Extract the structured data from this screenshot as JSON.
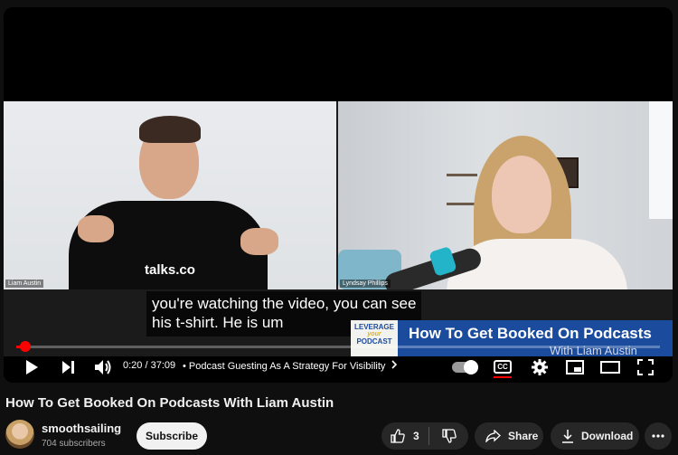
{
  "video": {
    "left_name_tag": "Liam Austin",
    "right_name_tag": "Lyndsay Phillips",
    "shirt_logo": "talks.co",
    "caption_line1": "you're watching the video, you can see",
    "caption_line2": "his t-shirt. He is um",
    "lower_third": {
      "badge_line1": "LEVERAGE",
      "badge_line2": "your",
      "badge_line3": "PODCAST",
      "title": "How To Get Booked On Podcasts",
      "subtitle": "With Liam Austin"
    }
  },
  "player": {
    "progress_fraction": 0.009,
    "time_current": "0:20",
    "time_separator": "/",
    "time_total": "37:09",
    "chapter_label": "Podcast Guesting As A Strategy For Visibility",
    "cc_label": "CC",
    "accent_color": "#ff0000"
  },
  "video_title": "How To Get Booked On Podcasts With Liam Austin",
  "channel": {
    "name": "smoothsailing",
    "subscribers": "704 subscribers",
    "subscribe_label": "Subscribe"
  },
  "actions": {
    "like_count": "3",
    "share_label": "Share",
    "download_label": "Download"
  },
  "icons": [
    "play-icon",
    "next-icon",
    "volume-icon",
    "chevron-right-icon",
    "autoplay-toggle",
    "cc-icon",
    "settings-gear-icon",
    "miniplayer-icon",
    "theater-icon",
    "fullscreen-icon",
    "like-icon",
    "dislike-icon",
    "share-icon",
    "download-icon",
    "more-icon"
  ]
}
